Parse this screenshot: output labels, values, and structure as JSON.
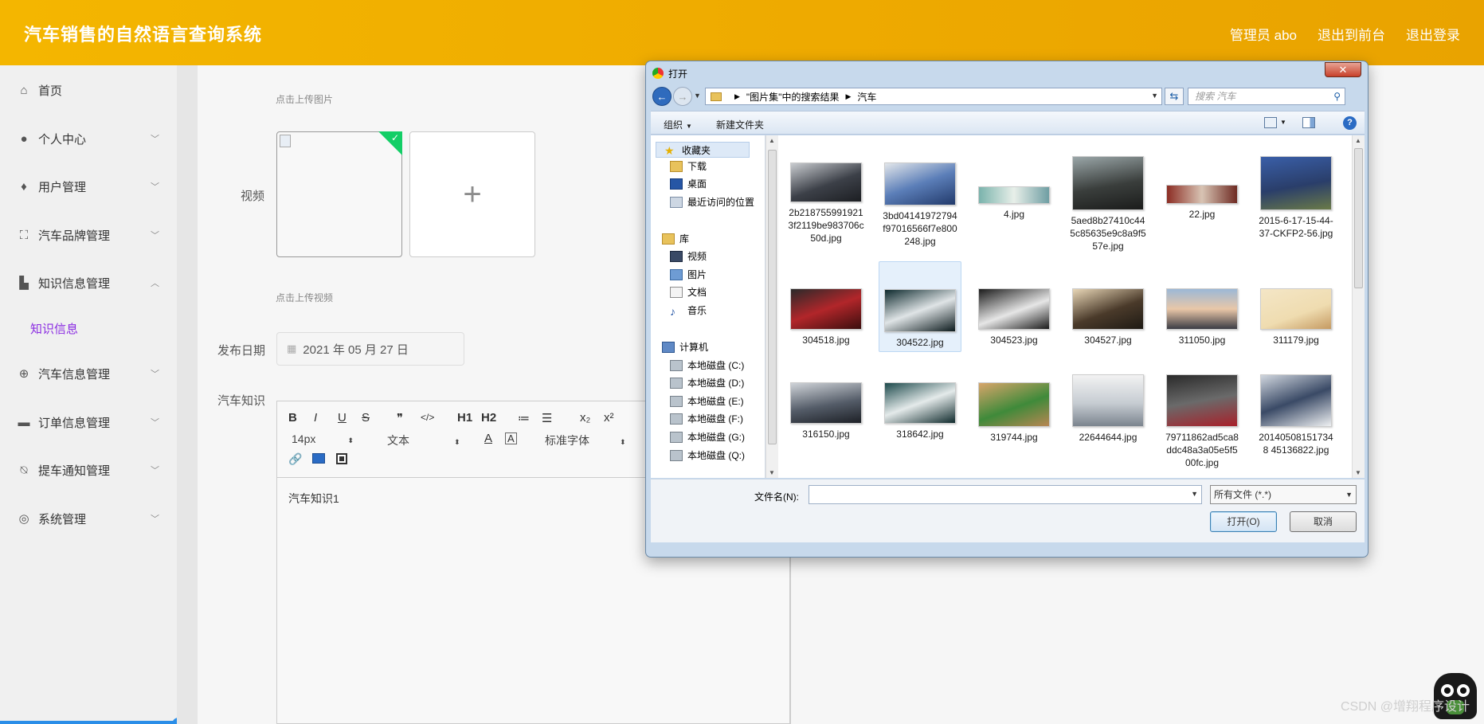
{
  "app": {
    "title": "汽车销售的自然语言查询系统"
  },
  "topnav": {
    "admin": "管理员 abo",
    "frontend": "退出到前台",
    "logout": "退出登录"
  },
  "sidebar": {
    "items": [
      {
        "label": "首页",
        "icon": "home-icon"
      },
      {
        "label": "个人中心",
        "icon": "user-icon"
      },
      {
        "label": "用户管理",
        "icon": "bulb-icon"
      },
      {
        "label": "汽车品牌管理",
        "icon": "frame-icon"
      },
      {
        "label": "知识信息管理",
        "icon": "case-icon"
      },
      {
        "label": "汽车信息管理",
        "icon": "compass-icon"
      },
      {
        "label": "订单信息管理",
        "icon": "monitor-icon"
      },
      {
        "label": "提车通知管理",
        "icon": "bell-off-icon"
      },
      {
        "label": "系统管理",
        "icon": "circle-icon"
      }
    ],
    "sub_item": "知识信息"
  },
  "form": {
    "upload_image_hint": "点击上传图片",
    "video_label": "视频",
    "upload_video_hint": "点击上传视频",
    "date_label": "发布日期",
    "date_value": "2021 年 05 月 27 日",
    "knowledge_label": "汽车知识"
  },
  "editor": {
    "font_size": "14px",
    "block_type": "文本",
    "font_family": "标准字体",
    "content": "汽车知识1",
    "buttons": [
      "B",
      "I",
      "U",
      "S",
      "❞",
      "</>",
      "H1",
      "H2",
      "≔",
      "☰",
      "x₂",
      "x²"
    ]
  },
  "dialog": {
    "title": "打开",
    "path_root": "\"图片集\"中的搜索结果",
    "path_leaf": "汽车",
    "search_placeholder": "搜索 汽车",
    "organize": "组织",
    "new_folder": "新建文件夹",
    "tree": {
      "favorites": "收藏夹",
      "downloads": "下载",
      "desktop": "桌面",
      "recent": "最近访问的位置",
      "library": "库",
      "videos": "视频",
      "pictures": "图片",
      "documents": "文档",
      "music": "音乐",
      "computer": "计算机",
      "disk_c": "本地磁盘 (C:)",
      "disk_d": "本地磁盘 (D:)",
      "disk_e": "本地磁盘 (E:)",
      "disk_f": "本地磁盘 (F:)",
      "disk_g": "本地磁盘 (G:)",
      "disk_q": "本地磁盘 (Q:)"
    },
    "files": [
      "2b2187559919213f2119be983706c50d.jpg",
      "3bd04141972794f97016566f7e800248.jpg",
      "4.jpg",
      "5aed8b27410c445c85635e9c8a9f557e.jpg",
      "22.jpg",
      "2015-6-17-15-44-37-CKFP2-56.jpg",
      "304518.jpg",
      "304522.jpg",
      "304523.jpg",
      "304527.jpg",
      "311050.jpg",
      "311179.jpg",
      "316150.jpg",
      "318642.jpg",
      "319744.jpg",
      "22644644.jpg",
      "79711862ad5ca8ddc48a3a05e5f500fc.jpg",
      "201405081517348 45136822.jpg"
    ],
    "file_name_label": "文件名(N):",
    "file_type": "所有文件 (*.*)",
    "open_button": "打开(O)",
    "cancel_button": "取消"
  },
  "watermark": "CSDN @增翔程序设计"
}
